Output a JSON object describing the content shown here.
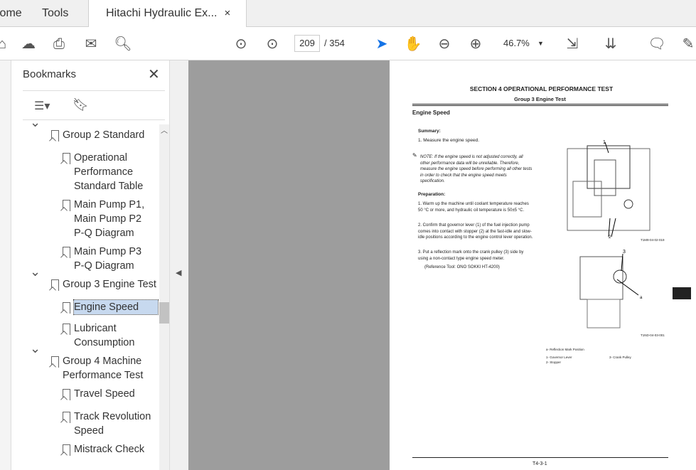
{
  "tabs": {
    "home": "Home",
    "tools": "Tools",
    "doc": "Hitachi Hydraulic Ex...",
    "close": "×"
  },
  "toolbar": {
    "page": "209",
    "total": "/ 354",
    "zoom": "46.7%"
  },
  "bookmarks": {
    "title": "Bookmarks",
    "close": "✕",
    "items": [
      {
        "label": "Group 2 Standard",
        "level": 0
      },
      {
        "label": "Operational Performance Standard Table",
        "level": 1,
        "lines": [
          "Operational",
          "Performance",
          "Standard Table"
        ]
      },
      {
        "label": "Main Pump P1, Main Pump P2 P-Q Diagram",
        "level": 1,
        "lines": [
          "Main Pump P1,",
          "Main Pump P2",
          "P-Q Diagram"
        ]
      },
      {
        "label": "Main Pump P3 P-Q Diagram",
        "level": 1,
        "lines": [
          "Main Pump P3",
          "P-Q Diagram"
        ]
      },
      {
        "label": "Group 3 Engine Test",
        "level": 0
      },
      {
        "label": "Engine Speed",
        "level": 1,
        "selected": true
      },
      {
        "label": "Lubricant Consumption",
        "level": 1,
        "lines": [
          "Lubricant",
          "Consumption"
        ]
      },
      {
        "label": "Group 4 Machine Performance Test",
        "level": 0,
        "lines": [
          "Group 4 Machine",
          "Performance Test"
        ]
      },
      {
        "label": "Travel Speed",
        "level": 1
      },
      {
        "label": "Track Revolution Speed",
        "level": 1,
        "lines": [
          "Track Revolution",
          "Speed"
        ]
      },
      {
        "label": "Mistrack Check",
        "level": 1
      }
    ]
  },
  "doc": {
    "section": "SECTION 4 OPERATIONAL PERFORMANCE TEST",
    "group": "Group 3 Engine Test",
    "heading": "Engine Speed",
    "summary_h": "Summary:",
    "summary_1": "1.  Measure the engine speed.",
    "note": "NOTE:   If the engine speed is not adjusted correctly, all other performance data will be unreliable. Therefore, measure the engine speed before performing all other tests in order to check that the engine speed meets specification.",
    "prep_h": "Preparation:",
    "prep_1": "1.  Warm up the machine until coolant temperature reaches 50 °C or more, and hydraulic oil temperature is 50±5 °C.",
    "prep_2": "2.  Confirm that governor lever (1) of the fuel injection pump comes into contact with stopper (2) at the fast-idle and slow-idle positions according to the engine control lever operation.",
    "prep_3": "3.  Put a reflection mark onto the crank pulley (3) side by using a non-contact type engine speed meter.",
    "ref": "(Reference Tool: ONO SOKKI HT-4200)",
    "fig1": "T1M9-04-02-019",
    "fig2": "T1ND-04-03-001",
    "legend_a": "a-    Reflection Mark Position",
    "legend_1": "1-    Governor Lever",
    "legend_2": "2-    Stopper",
    "legend_3": "3-    Crank Pulley",
    "footer": "T4-3-1"
  }
}
